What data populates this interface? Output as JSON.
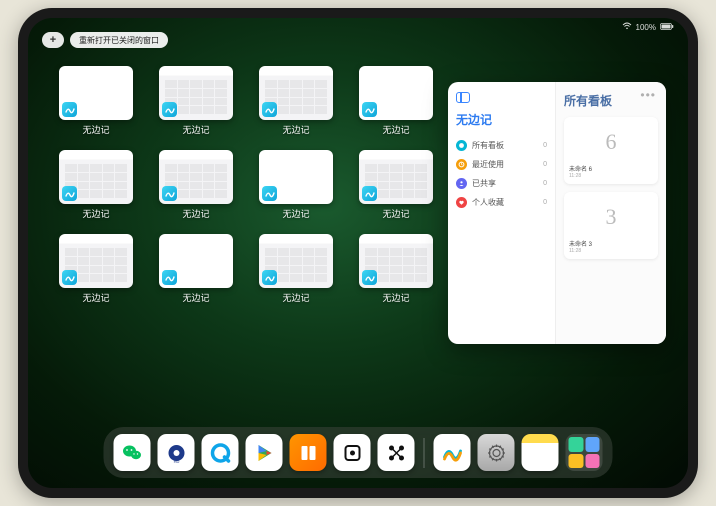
{
  "status": {
    "battery_text": "100%"
  },
  "top": {
    "plus": "+",
    "reopen_label": "重新打开已关闭的窗口"
  },
  "app_windows": {
    "label": "无边记",
    "items": [
      {
        "has_content": false
      },
      {
        "has_content": true
      },
      {
        "has_content": true
      },
      {
        "has_content": false
      },
      {
        "has_content": true
      },
      {
        "has_content": true
      },
      {
        "has_content": false
      },
      {
        "has_content": true
      },
      {
        "has_content": true
      },
      {
        "has_content": false
      },
      {
        "has_content": true
      },
      {
        "has_content": true
      }
    ]
  },
  "panel": {
    "left_title": "无边记",
    "right_title": "所有看板",
    "nav": [
      {
        "icon": "chat",
        "color": "ic-blue",
        "label": "所有看板",
        "count": 0
      },
      {
        "icon": "clock",
        "color": "ic-orange",
        "label": "最近使用",
        "count": 0
      },
      {
        "icon": "person",
        "color": "ic-indigo",
        "label": "已共享",
        "count": 0
      },
      {
        "icon": "heart",
        "color": "ic-red",
        "label": "个人收藏",
        "count": 0
      }
    ],
    "boards": [
      {
        "sketch": "6",
        "name": "未命名 6",
        "time": "11:28"
      },
      {
        "sketch": "3",
        "name": "未命名 3",
        "time": "11:28"
      }
    ]
  },
  "dock": {
    "apps": [
      {
        "id": "wechat",
        "class": "di-wechat"
      },
      {
        "id": "q-hd",
        "class": "di-qhd"
      },
      {
        "id": "q-browser",
        "class": "di-q"
      },
      {
        "id": "play",
        "class": "di-play"
      },
      {
        "id": "books",
        "class": "di-books"
      },
      {
        "id": "dice",
        "class": "di-dice"
      },
      {
        "id": "nodes",
        "class": "di-dots"
      }
    ],
    "recent": [
      {
        "id": "freeform",
        "class": "di-freeform"
      },
      {
        "id": "settings",
        "class": "di-settings"
      },
      {
        "id": "notes",
        "class": "di-notes"
      }
    ]
  }
}
